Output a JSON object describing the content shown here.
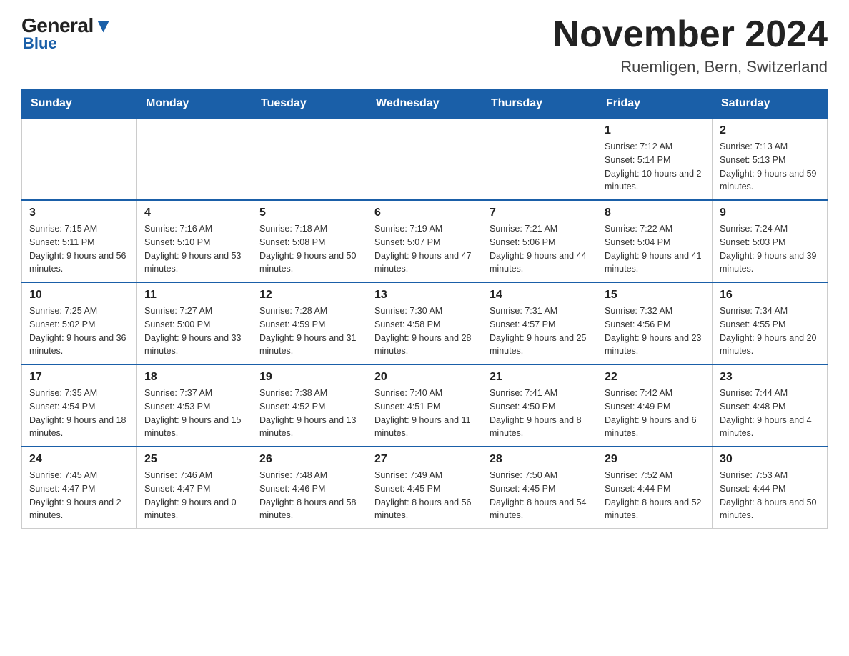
{
  "logo": {
    "name_part1": "General",
    "name_part2": "Blue"
  },
  "title": "November 2024",
  "subtitle": "Ruemligen, Bern, Switzerland",
  "days_of_week": [
    "Sunday",
    "Monday",
    "Tuesday",
    "Wednesday",
    "Thursday",
    "Friday",
    "Saturday"
  ],
  "weeks": [
    [
      {
        "day": null
      },
      {
        "day": null
      },
      {
        "day": null
      },
      {
        "day": null
      },
      {
        "day": null
      },
      {
        "day": 1,
        "sunrise": "7:12 AM",
        "sunset": "5:14 PM",
        "daylight": "10 hours and 2 minutes."
      },
      {
        "day": 2,
        "sunrise": "7:13 AM",
        "sunset": "5:13 PM",
        "daylight": "9 hours and 59 minutes."
      }
    ],
    [
      {
        "day": 3,
        "sunrise": "7:15 AM",
        "sunset": "5:11 PM",
        "daylight": "9 hours and 56 minutes."
      },
      {
        "day": 4,
        "sunrise": "7:16 AM",
        "sunset": "5:10 PM",
        "daylight": "9 hours and 53 minutes."
      },
      {
        "day": 5,
        "sunrise": "7:18 AM",
        "sunset": "5:08 PM",
        "daylight": "9 hours and 50 minutes."
      },
      {
        "day": 6,
        "sunrise": "7:19 AM",
        "sunset": "5:07 PM",
        "daylight": "9 hours and 47 minutes."
      },
      {
        "day": 7,
        "sunrise": "7:21 AM",
        "sunset": "5:06 PM",
        "daylight": "9 hours and 44 minutes."
      },
      {
        "day": 8,
        "sunrise": "7:22 AM",
        "sunset": "5:04 PM",
        "daylight": "9 hours and 41 minutes."
      },
      {
        "day": 9,
        "sunrise": "7:24 AM",
        "sunset": "5:03 PM",
        "daylight": "9 hours and 39 minutes."
      }
    ],
    [
      {
        "day": 10,
        "sunrise": "7:25 AM",
        "sunset": "5:02 PM",
        "daylight": "9 hours and 36 minutes."
      },
      {
        "day": 11,
        "sunrise": "7:27 AM",
        "sunset": "5:00 PM",
        "daylight": "9 hours and 33 minutes."
      },
      {
        "day": 12,
        "sunrise": "7:28 AM",
        "sunset": "4:59 PM",
        "daylight": "9 hours and 31 minutes."
      },
      {
        "day": 13,
        "sunrise": "7:30 AM",
        "sunset": "4:58 PM",
        "daylight": "9 hours and 28 minutes."
      },
      {
        "day": 14,
        "sunrise": "7:31 AM",
        "sunset": "4:57 PM",
        "daylight": "9 hours and 25 minutes."
      },
      {
        "day": 15,
        "sunrise": "7:32 AM",
        "sunset": "4:56 PM",
        "daylight": "9 hours and 23 minutes."
      },
      {
        "day": 16,
        "sunrise": "7:34 AM",
        "sunset": "4:55 PM",
        "daylight": "9 hours and 20 minutes."
      }
    ],
    [
      {
        "day": 17,
        "sunrise": "7:35 AM",
        "sunset": "4:54 PM",
        "daylight": "9 hours and 18 minutes."
      },
      {
        "day": 18,
        "sunrise": "7:37 AM",
        "sunset": "4:53 PM",
        "daylight": "9 hours and 15 minutes."
      },
      {
        "day": 19,
        "sunrise": "7:38 AM",
        "sunset": "4:52 PM",
        "daylight": "9 hours and 13 minutes."
      },
      {
        "day": 20,
        "sunrise": "7:40 AM",
        "sunset": "4:51 PM",
        "daylight": "9 hours and 11 minutes."
      },
      {
        "day": 21,
        "sunrise": "7:41 AM",
        "sunset": "4:50 PM",
        "daylight": "9 hours and 8 minutes."
      },
      {
        "day": 22,
        "sunrise": "7:42 AM",
        "sunset": "4:49 PM",
        "daylight": "9 hours and 6 minutes."
      },
      {
        "day": 23,
        "sunrise": "7:44 AM",
        "sunset": "4:48 PM",
        "daylight": "9 hours and 4 minutes."
      }
    ],
    [
      {
        "day": 24,
        "sunrise": "7:45 AM",
        "sunset": "4:47 PM",
        "daylight": "9 hours and 2 minutes."
      },
      {
        "day": 25,
        "sunrise": "7:46 AM",
        "sunset": "4:47 PM",
        "daylight": "9 hours and 0 minutes."
      },
      {
        "day": 26,
        "sunrise": "7:48 AM",
        "sunset": "4:46 PM",
        "daylight": "8 hours and 58 minutes."
      },
      {
        "day": 27,
        "sunrise": "7:49 AM",
        "sunset": "4:45 PM",
        "daylight": "8 hours and 56 minutes."
      },
      {
        "day": 28,
        "sunrise": "7:50 AM",
        "sunset": "4:45 PM",
        "daylight": "8 hours and 54 minutes."
      },
      {
        "day": 29,
        "sunrise": "7:52 AM",
        "sunset": "4:44 PM",
        "daylight": "8 hours and 52 minutes."
      },
      {
        "day": 30,
        "sunrise": "7:53 AM",
        "sunset": "4:44 PM",
        "daylight": "8 hours and 50 minutes."
      }
    ]
  ],
  "labels": {
    "sunrise": "Sunrise:",
    "sunset": "Sunset:",
    "daylight": "Daylight:"
  }
}
